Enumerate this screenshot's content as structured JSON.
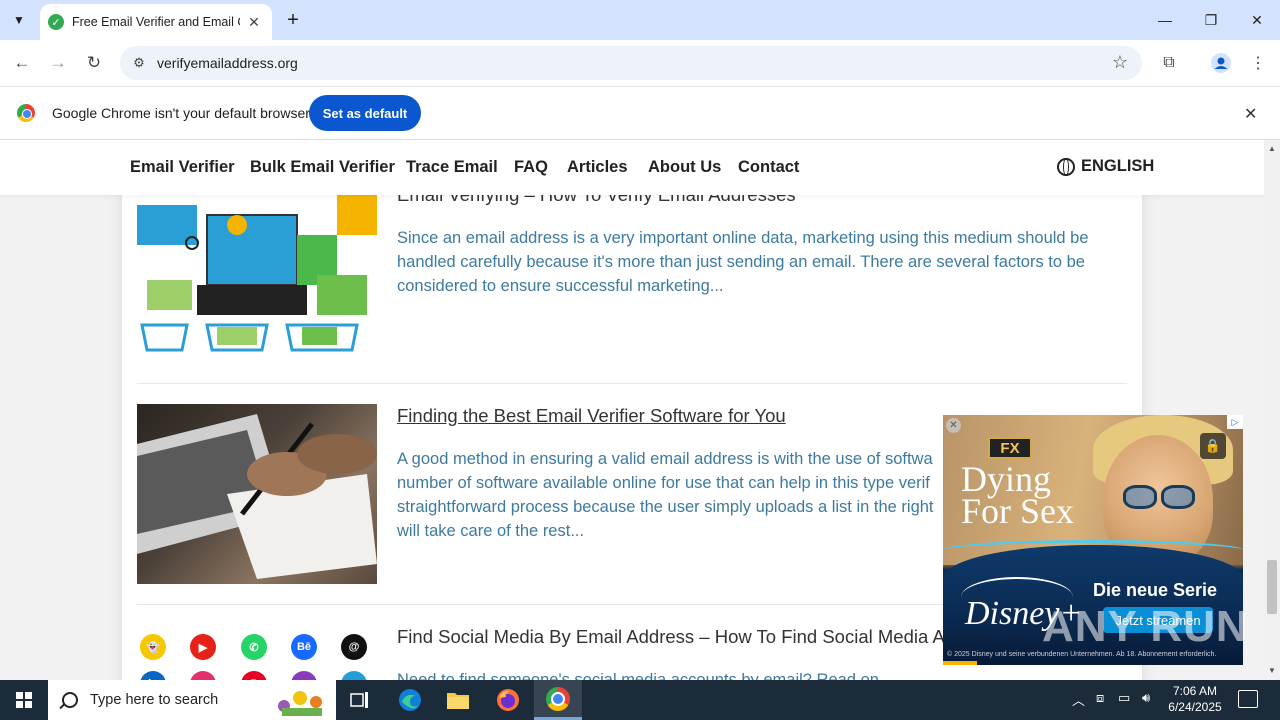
{
  "browser": {
    "tab_title": "Free Email Verifier and Email Ch",
    "url": "verifyemailaddress.org",
    "infobar_text": "Google Chrome isn't your default browser",
    "infobar_button": "Set as default"
  },
  "site_nav": {
    "items": [
      "Email Verifier",
      "Bulk Email Verifier",
      "Trace Email",
      "FAQ",
      "Articles",
      "About Us",
      "Contact"
    ],
    "language": "ENGLISH"
  },
  "articles": [
    {
      "title": "Email Verifying – How To Verify Email Addresses",
      "lines": [
        "Since an email address is a very important online data, marketing using this medium should be",
        "handled carefully because it's more than just sending an email. There are several factors to be",
        "considered to ensure successful marketing..."
      ]
    },
    {
      "title": "Finding the Best Email Verifier Software for You",
      "lines": [
        "A good method in ensuring a valid email address is with the use of softwa",
        "number of software available online for use that can help in this type verif",
        "straightforward process because the user simply uploads a list in the right",
        "will take care of the rest..."
      ]
    },
    {
      "title": "Find Social Media By Email Address – How To Find Social Media A",
      "lines": [
        "Need to find someone's social media accounts by email? Read on"
      ]
    }
  ],
  "ad": {
    "badge": "FX",
    "title_line1": "Dying",
    "title_line2": "For Sex",
    "brand": "Disney+",
    "tagline": "Die neue Serie",
    "cta": "Jetzt streamen",
    "fine_print": "© 2025 Disney und seine verbundenen Unternehmen. Ab 18. Abonnement erforderlich."
  },
  "watermark": "ANY RUN",
  "taskbar": {
    "search_placeholder": "Type here to search",
    "time": "7:06 AM",
    "date": "6/24/2025"
  },
  "colors": {
    "accent": "#0b57d0",
    "article_text": "#3d7aa0",
    "taskbar": "#1c2b3a"
  }
}
